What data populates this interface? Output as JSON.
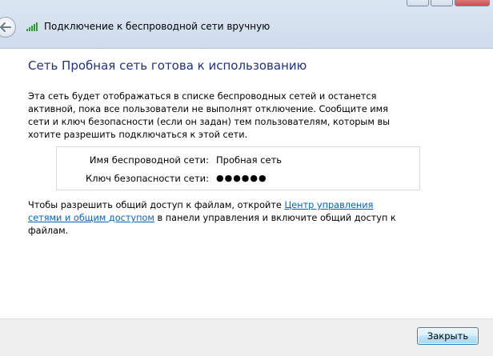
{
  "header": {
    "title": "Подключение к беспроводной сети вручную",
    "back_icon": "back-arrow-icon",
    "network_icon": "wireless-signal-icon"
  },
  "main": {
    "heading": "Сеть Пробная сеть готова к использованию",
    "description": "Эта сеть будет отображаться в списке беспроводных сетей и останется активной, пока все пользователи не выполнят отключение. Сообщите имя сети и ключ безопасности (если он задан) тем пользователям, которым вы хотите разрешить подключаться к этой сети.",
    "details": {
      "network_name_label": "Имя беспроводной сети:",
      "network_name_value": "Пробная сеть",
      "security_key_label": "Ключ безопасности сети:",
      "security_key_value": "●●●●●●"
    },
    "sharing": {
      "text_before": "Чтобы разрешить общий доступ к файлам, откройте ",
      "link": "Центр управления сетями и общим доступом",
      "text_after": " в панели управления и включите общий доступ к файлам."
    }
  },
  "footer": {
    "close_label": "Закрыть"
  },
  "colors": {
    "heading": "#1e3287",
    "link": "#0066cc",
    "signal": "#2e9e2e"
  }
}
